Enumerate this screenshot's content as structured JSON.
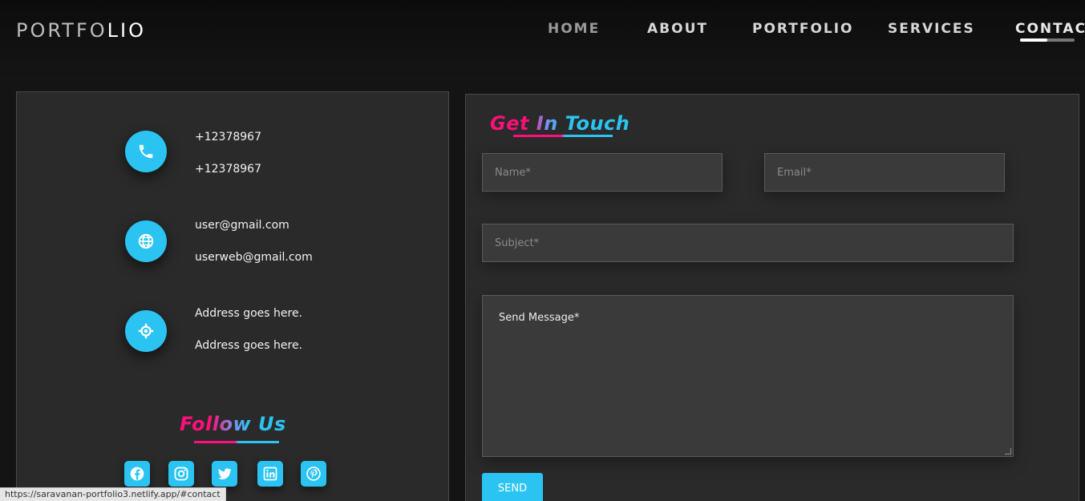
{
  "header": {
    "logo_part1": "PORTFO",
    "logo_part2": "LIO",
    "nav": [
      {
        "label": "HOME"
      },
      {
        "label": "ABOUT"
      },
      {
        "label": "PORTFOLIO"
      },
      {
        "label": "SERVICES"
      },
      {
        "label": "CONTACT"
      }
    ]
  },
  "contact_info": {
    "phone": [
      "+12378967",
      "+12378967"
    ],
    "email": [
      "user@gmail.com",
      "userweb@gmail.com"
    ],
    "address": [
      "Address goes here.",
      "Address goes here."
    ]
  },
  "follow": {
    "title": "Follow Us",
    "socials": [
      "facebook-icon",
      "instagram-icon",
      "twitter-icon",
      "linkedin-icon",
      "pinterest-icon"
    ]
  },
  "form": {
    "title": "Get In Touch",
    "name_placeholder": "Name*",
    "email_placeholder": "Email*",
    "subject_placeholder": "Subject*",
    "message_placeholder": "Send Message*",
    "send_label": "SEND"
  },
  "status_bar": {
    "url": "https://saravanan-portfolio3.netlify.app/#contact"
  },
  "colors": {
    "accent": "#2bc4f2",
    "pink": "#ff0f7b",
    "background": "#141414",
    "panel": "#2a2a2a"
  }
}
